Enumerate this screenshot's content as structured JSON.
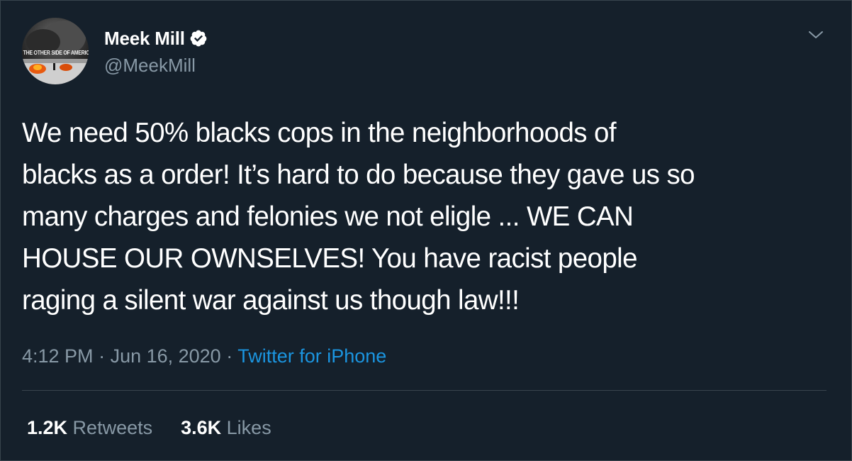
{
  "user": {
    "display_name": "Meek Mill",
    "handle": "@MeekMill",
    "avatar_text": "THE OTHER SIDE OF AMERICA",
    "verified": true
  },
  "tweet": {
    "text": "We need 50% blacks cops in the neighborhoods of\nblacks as a order! It’s hard to do because they gave us so\nmany charges and felonies we not eligle ... WE CAN\nHOUSE OUR OWNSELVES!  You have racist people\nraging a silent war against us though law!!!",
    "time": "4:12 PM",
    "date": "Jun 16, 2020",
    "separator": " · ",
    "source": "Twitter for iPhone"
  },
  "stats": {
    "retweets_count": "1.2K",
    "retweets_label": " Retweets",
    "likes_count": "3.6K",
    "likes_label": " Likes"
  },
  "icons": {
    "verified": "verified-badge-icon",
    "menu": "chevron-down-icon"
  },
  "colors": {
    "background": "#15202b",
    "text": "#ffffff",
    "secondary": "#8899a6",
    "accent": "#1b95e0",
    "divider": "#38444d"
  }
}
